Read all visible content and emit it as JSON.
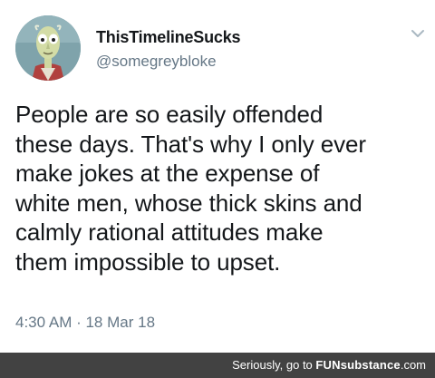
{
  "tweet": {
    "display_name": "ThisTimelineSucks",
    "handle": "@somegreybloke",
    "text": "People are so easily offended\nthese days. That's why I only ever\nmake jokes at the expense of\nwhite men, whose thick skins and\ncalmly rational attitudes make\nthem impossible to upset.",
    "timestamp": "4:30 AM · 18 Mar 18",
    "menu_icon": "chevron-down-icon"
  },
  "footer": {
    "prefix": "Seriously, go to ",
    "brand": "FUNsubstance",
    "suffix": ".com",
    "background_color": "#424242"
  },
  "colors": {
    "text": "#14171a",
    "secondary": "#657786"
  }
}
